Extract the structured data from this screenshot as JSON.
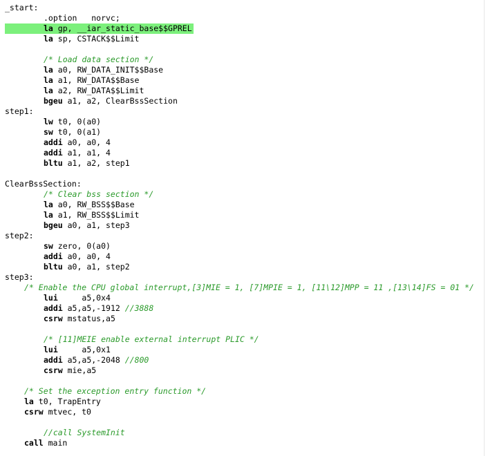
{
  "editor": {
    "highlight_color": "#7cf07c",
    "comment_color": "#2a9a2a",
    "lines": [
      {
        "indent": 0,
        "segments": [
          {
            "text": "_start:",
            "style": "plain"
          }
        ]
      },
      {
        "indent": 2,
        "segments": [
          {
            "text": ".option   norvc;",
            "style": "plain"
          }
        ]
      },
      {
        "indent": 2,
        "current": true,
        "segments": [
          {
            "text": "la",
            "style": "kw"
          },
          {
            "text": " gp, __iar_static_base$$GPREL",
            "style": "plain"
          }
        ]
      },
      {
        "indent": 2,
        "segments": [
          {
            "text": "la",
            "style": "kw"
          },
          {
            "text": " sp, CSTACK$$Limit",
            "style": "plain"
          }
        ]
      },
      {
        "indent": 0,
        "segments": []
      },
      {
        "indent": 2,
        "segments": [
          {
            "text": "/* Load data section */",
            "style": "comment"
          }
        ]
      },
      {
        "indent": 2,
        "segments": [
          {
            "text": "la",
            "style": "kw"
          },
          {
            "text": " a0, RW_DATA_INIT$$Base",
            "style": "plain"
          }
        ]
      },
      {
        "indent": 2,
        "segments": [
          {
            "text": "la",
            "style": "kw"
          },
          {
            "text": " a1, RW_DATA$$Base",
            "style": "plain"
          }
        ]
      },
      {
        "indent": 2,
        "segments": [
          {
            "text": "la",
            "style": "kw"
          },
          {
            "text": " a2, RW_DATA$$Limit",
            "style": "plain"
          }
        ]
      },
      {
        "indent": 2,
        "segments": [
          {
            "text": "bgeu",
            "style": "kw"
          },
          {
            "text": " a1, a2, ClearBssSection",
            "style": "plain"
          }
        ]
      },
      {
        "indent": 0,
        "segments": [
          {
            "text": "step1:",
            "style": "plain"
          }
        ]
      },
      {
        "indent": 2,
        "segments": [
          {
            "text": "lw",
            "style": "kw"
          },
          {
            "text": " t0, 0(a0)",
            "style": "plain"
          }
        ]
      },
      {
        "indent": 2,
        "segments": [
          {
            "text": "sw",
            "style": "kw"
          },
          {
            "text": " t0, 0(a1)",
            "style": "plain"
          }
        ]
      },
      {
        "indent": 2,
        "segments": [
          {
            "text": "addi",
            "style": "kw"
          },
          {
            "text": " a0, a0, 4",
            "style": "plain"
          }
        ]
      },
      {
        "indent": 2,
        "segments": [
          {
            "text": "addi",
            "style": "kw"
          },
          {
            "text": " a1, a1, 4",
            "style": "plain"
          }
        ]
      },
      {
        "indent": 2,
        "segments": [
          {
            "text": "bltu",
            "style": "kw"
          },
          {
            "text": " a1, a2, step1",
            "style": "plain"
          }
        ]
      },
      {
        "indent": 0,
        "segments": []
      },
      {
        "indent": 0,
        "segments": [
          {
            "text": "ClearBssSection:",
            "style": "plain"
          }
        ]
      },
      {
        "indent": 2,
        "segments": [
          {
            "text": "/* Clear bss section */",
            "style": "comment"
          }
        ]
      },
      {
        "indent": 2,
        "segments": [
          {
            "text": "la",
            "style": "kw"
          },
          {
            "text": " a0, RW_BSS$$Base",
            "style": "plain"
          }
        ]
      },
      {
        "indent": 2,
        "segments": [
          {
            "text": "la",
            "style": "kw"
          },
          {
            "text": " a1, RW_BSS$$Limit",
            "style": "plain"
          }
        ]
      },
      {
        "indent": 2,
        "segments": [
          {
            "text": "bgeu",
            "style": "kw"
          },
          {
            "text": " a0, a1, step3",
            "style": "plain"
          }
        ]
      },
      {
        "indent": 0,
        "segments": [
          {
            "text": "step2:",
            "style": "plain"
          }
        ]
      },
      {
        "indent": 2,
        "segments": [
          {
            "text": "sw",
            "style": "kw"
          },
          {
            "text": " zero, 0(a0)",
            "style": "plain"
          }
        ]
      },
      {
        "indent": 2,
        "segments": [
          {
            "text": "addi",
            "style": "kw"
          },
          {
            "text": " a0, a0, 4",
            "style": "plain"
          }
        ]
      },
      {
        "indent": 2,
        "segments": [
          {
            "text": "bltu",
            "style": "kw"
          },
          {
            "text": " a0, a1, step2",
            "style": "plain"
          }
        ]
      },
      {
        "indent": 0,
        "segments": [
          {
            "text": "step3:",
            "style": "plain"
          }
        ]
      },
      {
        "indent": 1,
        "segments": [
          {
            "text": "/* Enable the CPU global interrupt,[3]MIE = 1, [7]MPIE = 1, [11\\12]MPP = 11 ,[13\\14]FS = 01 */",
            "style": "comment"
          }
        ]
      },
      {
        "indent": 2,
        "segments": [
          {
            "text": "lui",
            "style": "kw"
          },
          {
            "text": "     a5,0x4",
            "style": "plain"
          }
        ]
      },
      {
        "indent": 2,
        "segments": [
          {
            "text": "addi",
            "style": "kw"
          },
          {
            "text": " a5,a5,-1912 ",
            "style": "plain"
          },
          {
            "text": "//3888",
            "style": "comment"
          }
        ]
      },
      {
        "indent": 2,
        "segments": [
          {
            "text": "csrw",
            "style": "kw"
          },
          {
            "text": " mstatus,a5",
            "style": "plain"
          }
        ]
      },
      {
        "indent": 0,
        "segments": []
      },
      {
        "indent": 2,
        "segments": [
          {
            "text": "/* [11]MEIE enable external interrupt PLIC */",
            "style": "comment"
          }
        ]
      },
      {
        "indent": 2,
        "segments": [
          {
            "text": "lui",
            "style": "kw"
          },
          {
            "text": "     a5,0x1",
            "style": "plain"
          }
        ]
      },
      {
        "indent": 2,
        "segments": [
          {
            "text": "addi",
            "style": "kw"
          },
          {
            "text": " a5,a5,-2048 ",
            "style": "plain"
          },
          {
            "text": "//800",
            "style": "comment"
          }
        ]
      },
      {
        "indent": 2,
        "segments": [
          {
            "text": "csrw",
            "style": "kw"
          },
          {
            "text": " mie,a5",
            "style": "plain"
          }
        ]
      },
      {
        "indent": 0,
        "segments": []
      },
      {
        "indent": 1,
        "segments": [
          {
            "text": "/* Set the exception entry function */",
            "style": "comment"
          }
        ]
      },
      {
        "indent": 1,
        "segments": [
          {
            "text": "la",
            "style": "kw"
          },
          {
            "text": " t0, TrapEntry",
            "style": "plain"
          }
        ]
      },
      {
        "indent": 1,
        "segments": [
          {
            "text": "csrw",
            "style": "kw"
          },
          {
            "text": " mtvec, t0",
            "style": "plain"
          }
        ]
      },
      {
        "indent": 0,
        "segments": []
      },
      {
        "indent": 2,
        "segments": [
          {
            "text": "//call SystemInit",
            "style": "comment"
          }
        ]
      },
      {
        "indent": 1,
        "segments": [
          {
            "text": "call",
            "style": "kw"
          },
          {
            "text": " main",
            "style": "plain"
          }
        ]
      }
    ]
  }
}
